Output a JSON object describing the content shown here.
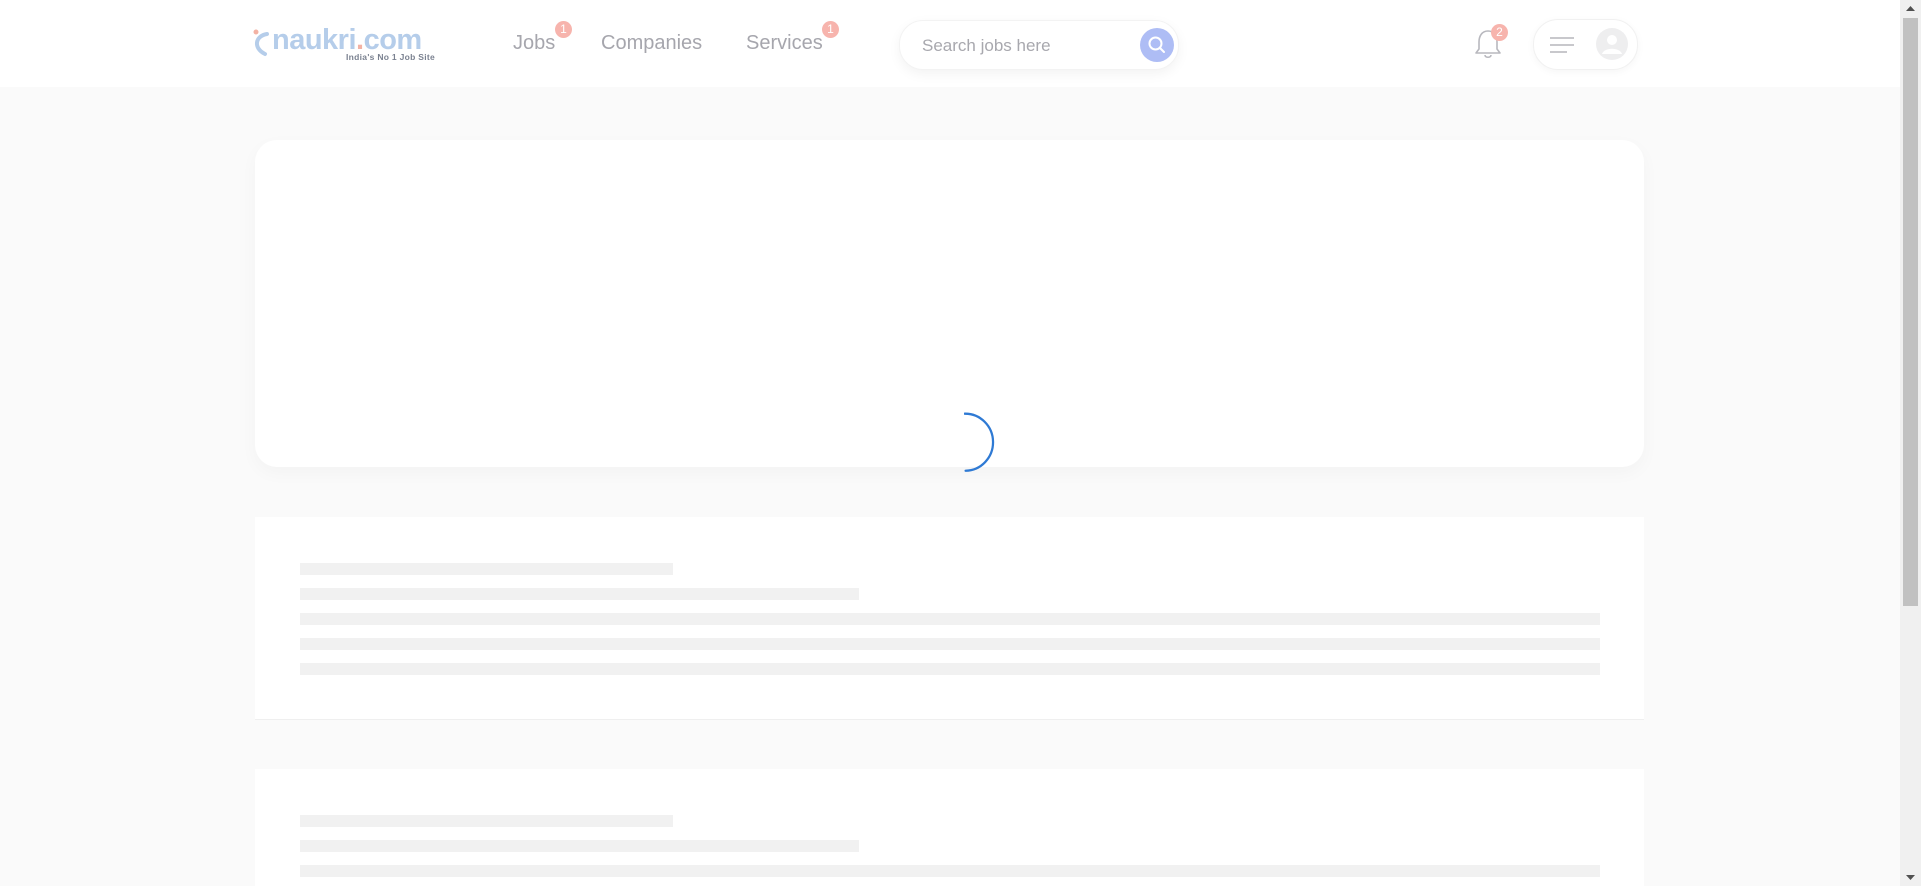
{
  "header": {
    "logo": {
      "brand_text_main": "naukri",
      "brand_text_dot": ".",
      "brand_text_tld": "com",
      "tagline": "India's No 1 Job Site"
    },
    "nav": [
      {
        "label": "Jobs",
        "badge": "1"
      },
      {
        "label": "Companies",
        "badge": ""
      },
      {
        "label": "Services",
        "badge": "1"
      }
    ],
    "search": {
      "placeholder": "Search jobs here",
      "icon": "search-icon"
    },
    "notifications": {
      "icon": "bell-icon",
      "badge": "2"
    },
    "profile": {
      "menu_icon": "hamburger-icon",
      "avatar_icon": "user-avatar-icon"
    }
  },
  "main": {
    "loading": true,
    "spinner_color": "#2f7ad4"
  },
  "colors": {
    "badge": "#f7b4ad",
    "search_button": "#aebdf5",
    "logo_blue": "#b5cdea",
    "logo_accent": "#f3b2a4"
  }
}
